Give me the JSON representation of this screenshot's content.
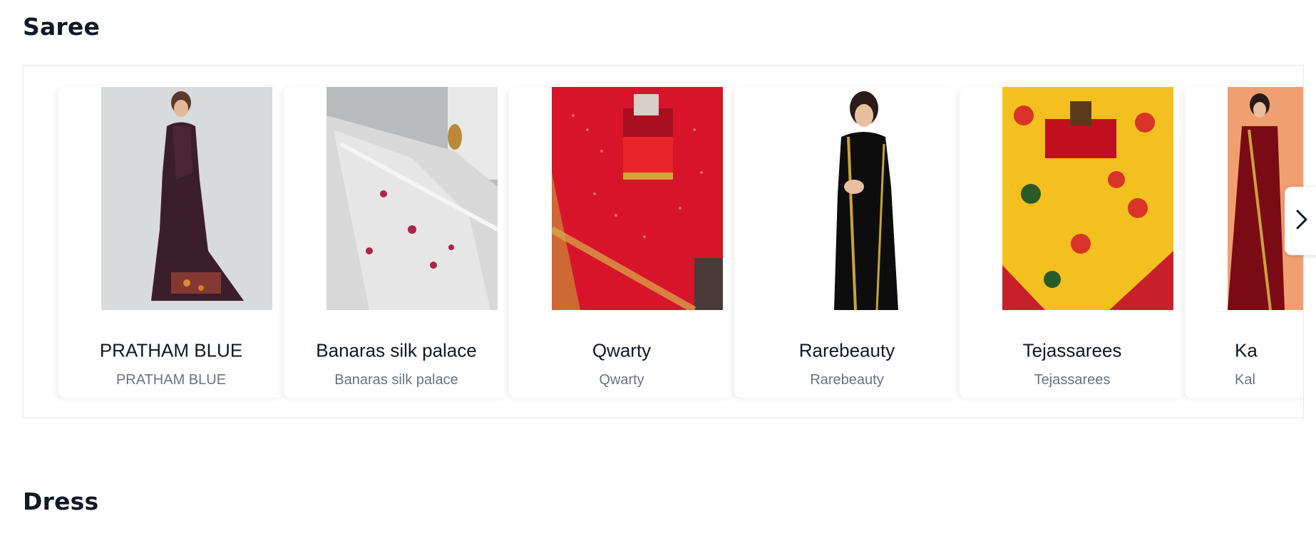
{
  "sections": {
    "saree": {
      "title": "Saree"
    },
    "dress": {
      "title": "Dress"
    }
  },
  "products": [
    {
      "name": "PRATHAM BLUE",
      "brand": "PRATHAM BLUE"
    },
    {
      "name": "Banaras silk palace",
      "brand": "Banaras silk palace"
    },
    {
      "name": "Qwarty",
      "brand": "Qwarty"
    },
    {
      "name": "Rarebeauty",
      "brand": "Rarebeauty"
    },
    {
      "name": "Tejassarees",
      "brand": "Tejassarees"
    },
    {
      "name": "Ka",
      "brand": "Kal"
    }
  ],
  "carousel": {
    "next_icon": "chevron-right-icon"
  },
  "colors": {
    "title": "#111827",
    "subtitle": "#6b7280",
    "border": "#e5e7eb"
  }
}
